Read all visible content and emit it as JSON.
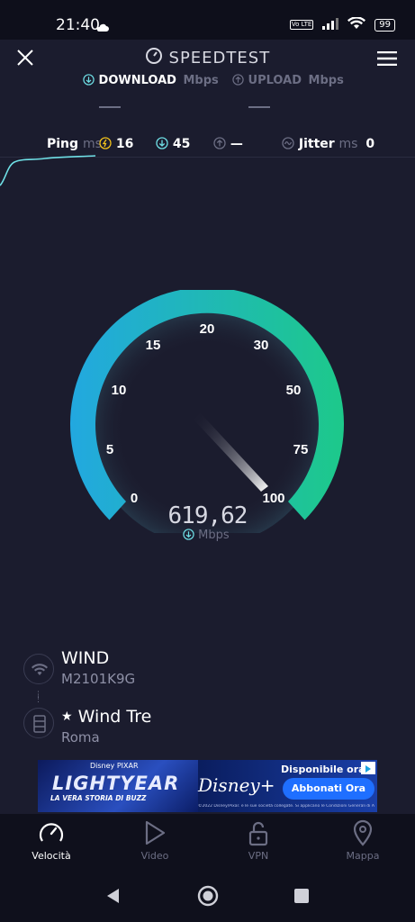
{
  "status_bar": {
    "time": "21:40",
    "lte": "Vo LTE",
    "battery": "99"
  },
  "header": {
    "title": "SPEEDTEST"
  },
  "tabs": {
    "download_label": "DOWNLOAD",
    "download_unit": "Mbps",
    "upload_label": "UPLOAD",
    "upload_unit": "Mbps"
  },
  "metrics": {
    "ping_label": "Ping",
    "ping_unit": "ms",
    "ping_value": "16",
    "download_ping": "45",
    "upload_ping": "—",
    "jitter_label": "Jitter",
    "jitter_unit": "ms",
    "jitter_value": "0"
  },
  "gauge": {
    "ticks": [
      "0",
      "5",
      "10",
      "15",
      "20",
      "30",
      "50",
      "75",
      "100"
    ],
    "reading": "619,62",
    "reading_unit": "Mbps"
  },
  "connection": {
    "network_name": "WIND",
    "device_model": "M2101K9G",
    "server_name": "Wind Tre",
    "server_location": "Roma"
  },
  "ad": {
    "brand_top": "Disney PIXAR",
    "movie_title": "LIGHTYEAR",
    "movie_subtitle": "LA VERA STORIA DI BUZZ",
    "available_text": "Disponibile ora",
    "disney_plus": "Disney+",
    "cta": "Abbonati Ora",
    "fineprint": "©2022 Disney/Pixar. e le sue società collegate. Si applicano le Condizioni Generali di Abbonamento."
  },
  "bottom_nav": [
    {
      "label": "Velocità",
      "icon": "speedometer-icon"
    },
    {
      "label": "Video",
      "icon": "play-icon"
    },
    {
      "label": "VPN",
      "icon": "unlock-icon"
    },
    {
      "label": "Mappa",
      "icon": "map-pin-icon"
    }
  ],
  "colors": {
    "background": "#1b1c2e",
    "gauge_start": "#22a8e0",
    "gauge_end": "#1dc98a",
    "active_tab": "#ffffff",
    "muted": "#6c6e84",
    "cyan_accent": "#6fe0e6"
  }
}
